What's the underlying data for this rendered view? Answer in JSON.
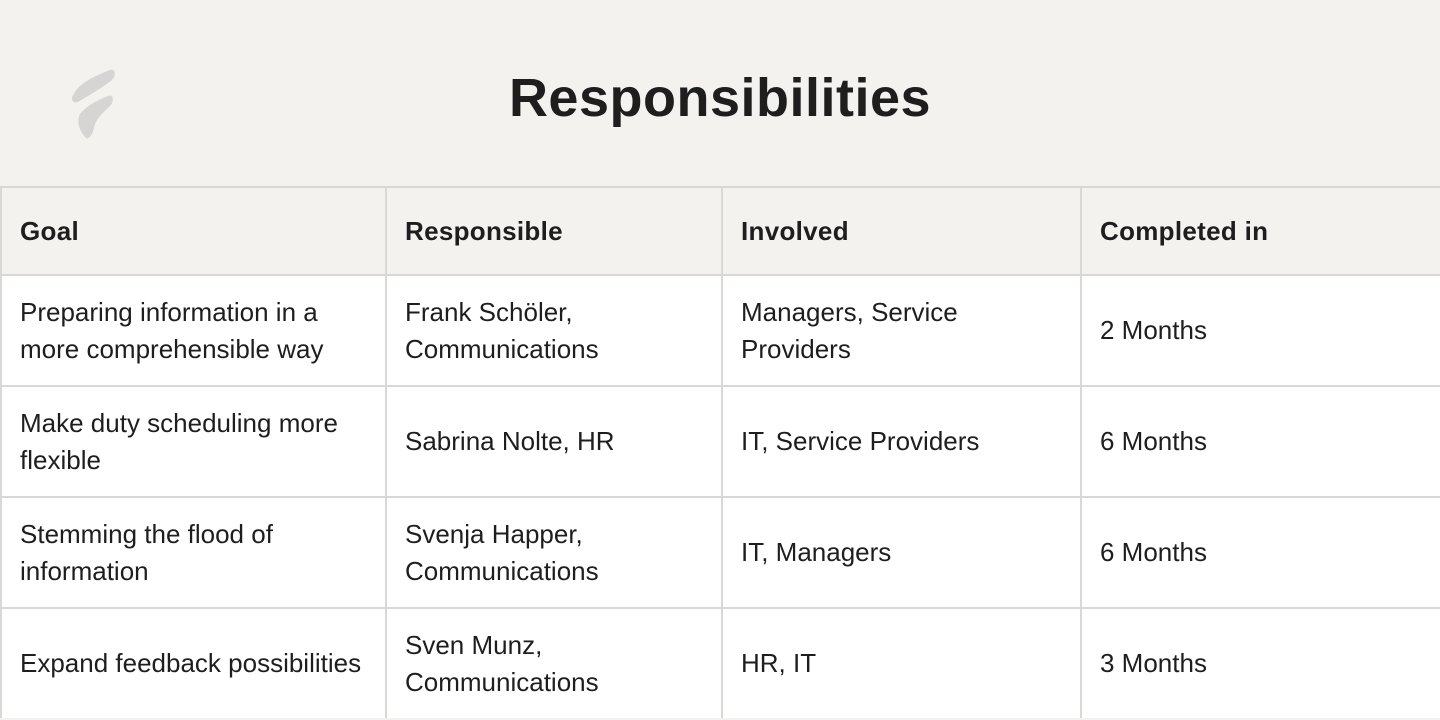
{
  "header": {
    "title": "Responsibilities",
    "logo_icon": "brand-logo-icon"
  },
  "table": {
    "columns": [
      "Goal",
      "Responsible",
      "Involved",
      "Completed in"
    ],
    "rows": [
      {
        "goal": "Preparing information in a more comprehensible way",
        "responsible": "Frank Schöler, Communications",
        "involved": "Managers, Service Providers",
        "completed_in": "2 Months"
      },
      {
        "goal": "Make duty scheduling more flexible",
        "responsible": "Sabrina Nolte, HR",
        "involved": "IT, Service Providers",
        "completed_in": "6 Months"
      },
      {
        "goal": "Stemming the flood of information",
        "responsible": "Svenja Happer, Communications",
        "involved": "IT, Managers",
        "completed_in": "6 Months"
      },
      {
        "goal": "Expand feedback possibilities",
        "responsible": "Sven Munz, Communications",
        "involved": "HR, IT",
        "completed_in": "3 Months"
      }
    ]
  },
  "colors": {
    "background": "#f3f2ef",
    "cell_background": "#ffffff",
    "border": "#d9d8d6",
    "text": "#1e1e1e",
    "logo": "#d6d5d3"
  }
}
